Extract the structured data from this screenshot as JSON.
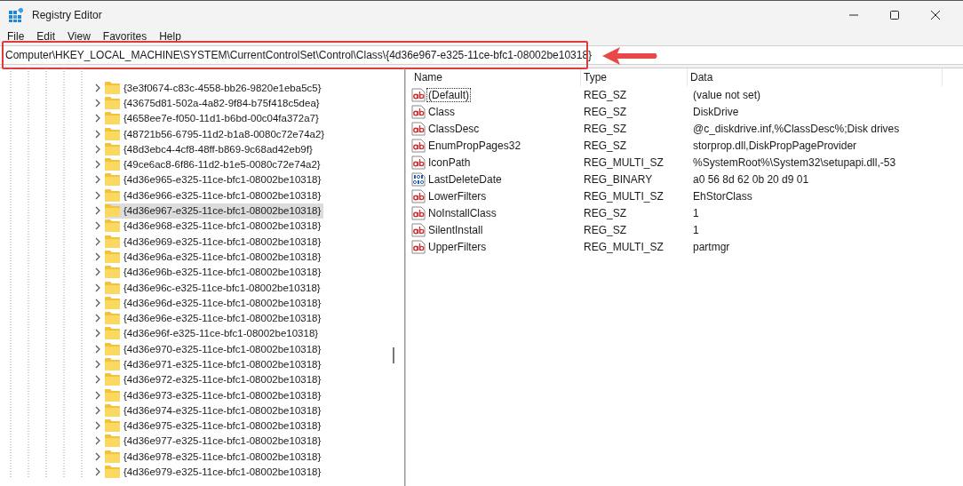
{
  "window": {
    "title": "Registry Editor"
  },
  "menu": [
    "File",
    "Edit",
    "View",
    "Favorites",
    "Help"
  ],
  "address": {
    "value": "Computer\\HKEY_LOCAL_MACHINE\\SYSTEM\\CurrentControlSet\\Control\\Class\\{4d36e967-e325-11ce-bfc1-08002be10318}"
  },
  "tree": {
    "items": [
      {
        "label": "{3e3f0674-c83c-4558-bb26-9820e1eba5c5}",
        "selected": false,
        "expanded": false
      },
      {
        "label": "{43675d81-502a-4a82-9f84-b75f418c5dea}",
        "selected": false,
        "expanded": false
      },
      {
        "label": "{4658ee7e-f050-11d1-b6bd-00c04fa372a7}",
        "selected": false,
        "expanded": false
      },
      {
        "label": "{48721b56-6795-11d2-b1a8-0080c72e74a2}",
        "selected": false,
        "expanded": false
      },
      {
        "label": "{48d3ebc4-4cf8-48ff-b869-9c68ad42eb9f}",
        "selected": false,
        "expanded": false
      },
      {
        "label": "{49ce6ac8-6f86-11d2-b1e5-0080c72e74a2}",
        "selected": false,
        "expanded": false
      },
      {
        "label": "{4d36e965-e325-11ce-bfc1-08002be10318}",
        "selected": false,
        "expanded": false
      },
      {
        "label": "{4d36e966-e325-11ce-bfc1-08002be10318}",
        "selected": false,
        "expanded": false
      },
      {
        "label": "{4d36e967-e325-11ce-bfc1-08002be10318}",
        "selected": true,
        "expanded": false
      },
      {
        "label": "{4d36e968-e325-11ce-bfc1-08002be10318}",
        "selected": false,
        "expanded": false
      },
      {
        "label": "{4d36e969-e325-11ce-bfc1-08002be10318}",
        "selected": false,
        "expanded": false
      },
      {
        "label": "{4d36e96a-e325-11ce-bfc1-08002be10318}",
        "selected": false,
        "expanded": false
      },
      {
        "label": "{4d36e96b-e325-11ce-bfc1-08002be10318}",
        "selected": false,
        "expanded": false
      },
      {
        "label": "{4d36e96c-e325-11ce-bfc1-08002be10318}",
        "selected": false,
        "expanded": false
      },
      {
        "label": "{4d36e96d-e325-11ce-bfc1-08002be10318}",
        "selected": false,
        "expanded": false
      },
      {
        "label": "{4d36e96e-e325-11ce-bfc1-08002be10318}",
        "selected": false,
        "expanded": false
      },
      {
        "label": "{4d36e96f-e325-11ce-bfc1-08002be10318}",
        "selected": false,
        "expanded": false
      },
      {
        "label": "{4d36e970-e325-11ce-bfc1-08002be10318}",
        "selected": false,
        "expanded": false
      },
      {
        "label": "{4d36e971-e325-11ce-bfc1-08002be10318}",
        "selected": false,
        "expanded": false
      },
      {
        "label": "{4d36e972-e325-11ce-bfc1-08002be10318}",
        "selected": false,
        "expanded": false
      },
      {
        "label": "{4d36e973-e325-11ce-bfc1-08002be10318}",
        "selected": false,
        "expanded": false
      },
      {
        "label": "{4d36e974-e325-11ce-bfc1-08002be10318}",
        "selected": false,
        "expanded": false
      },
      {
        "label": "{4d36e975-e325-11ce-bfc1-08002be10318}",
        "selected": false,
        "expanded": false
      },
      {
        "label": "{4d36e977-e325-11ce-bfc1-08002be10318}",
        "selected": false,
        "expanded": false
      },
      {
        "label": "{4d36e978-e325-11ce-bfc1-08002be10318}",
        "selected": false,
        "expanded": false
      },
      {
        "label": "{4d36e979-e325-11ce-bfc1-08002be10318}",
        "selected": false,
        "expanded": false
      }
    ]
  },
  "values": {
    "columns": [
      "Name",
      "Type",
      "Data"
    ],
    "rows": [
      {
        "kind": "string",
        "name": "(Default)",
        "type": "REG_SZ",
        "data": "(value not set)",
        "focused": true
      },
      {
        "kind": "string",
        "name": "Class",
        "type": "REG_SZ",
        "data": "DiskDrive",
        "focused": false
      },
      {
        "kind": "string",
        "name": "ClassDesc",
        "type": "REG_SZ",
        "data": "@c_diskdrive.inf,%ClassDesc%;Disk drives",
        "focused": false
      },
      {
        "kind": "string",
        "name": "EnumPropPages32",
        "type": "REG_SZ",
        "data": "storprop.dll,DiskPropPageProvider",
        "focused": false
      },
      {
        "kind": "string",
        "name": "IconPath",
        "type": "REG_MULTI_SZ",
        "data": "%SystemRoot%\\System32\\setupapi.dll,-53",
        "focused": false
      },
      {
        "kind": "binary",
        "name": "LastDeleteDate",
        "type": "REG_BINARY",
        "data": "a0 56 8d 62 0b 20 d9 01",
        "focused": false
      },
      {
        "kind": "string",
        "name": "LowerFilters",
        "type": "REG_MULTI_SZ",
        "data": "EhStorClass",
        "focused": false
      },
      {
        "kind": "string",
        "name": "NoInstallClass",
        "type": "REG_SZ",
        "data": "1",
        "focused": false
      },
      {
        "kind": "string",
        "name": "SilentInstall",
        "type": "REG_SZ",
        "data": "1",
        "focused": false
      },
      {
        "kind": "string",
        "name": "UpperFilters",
        "type": "REG_MULTI_SZ",
        "data": "partmgr",
        "focused": false
      }
    ]
  }
}
